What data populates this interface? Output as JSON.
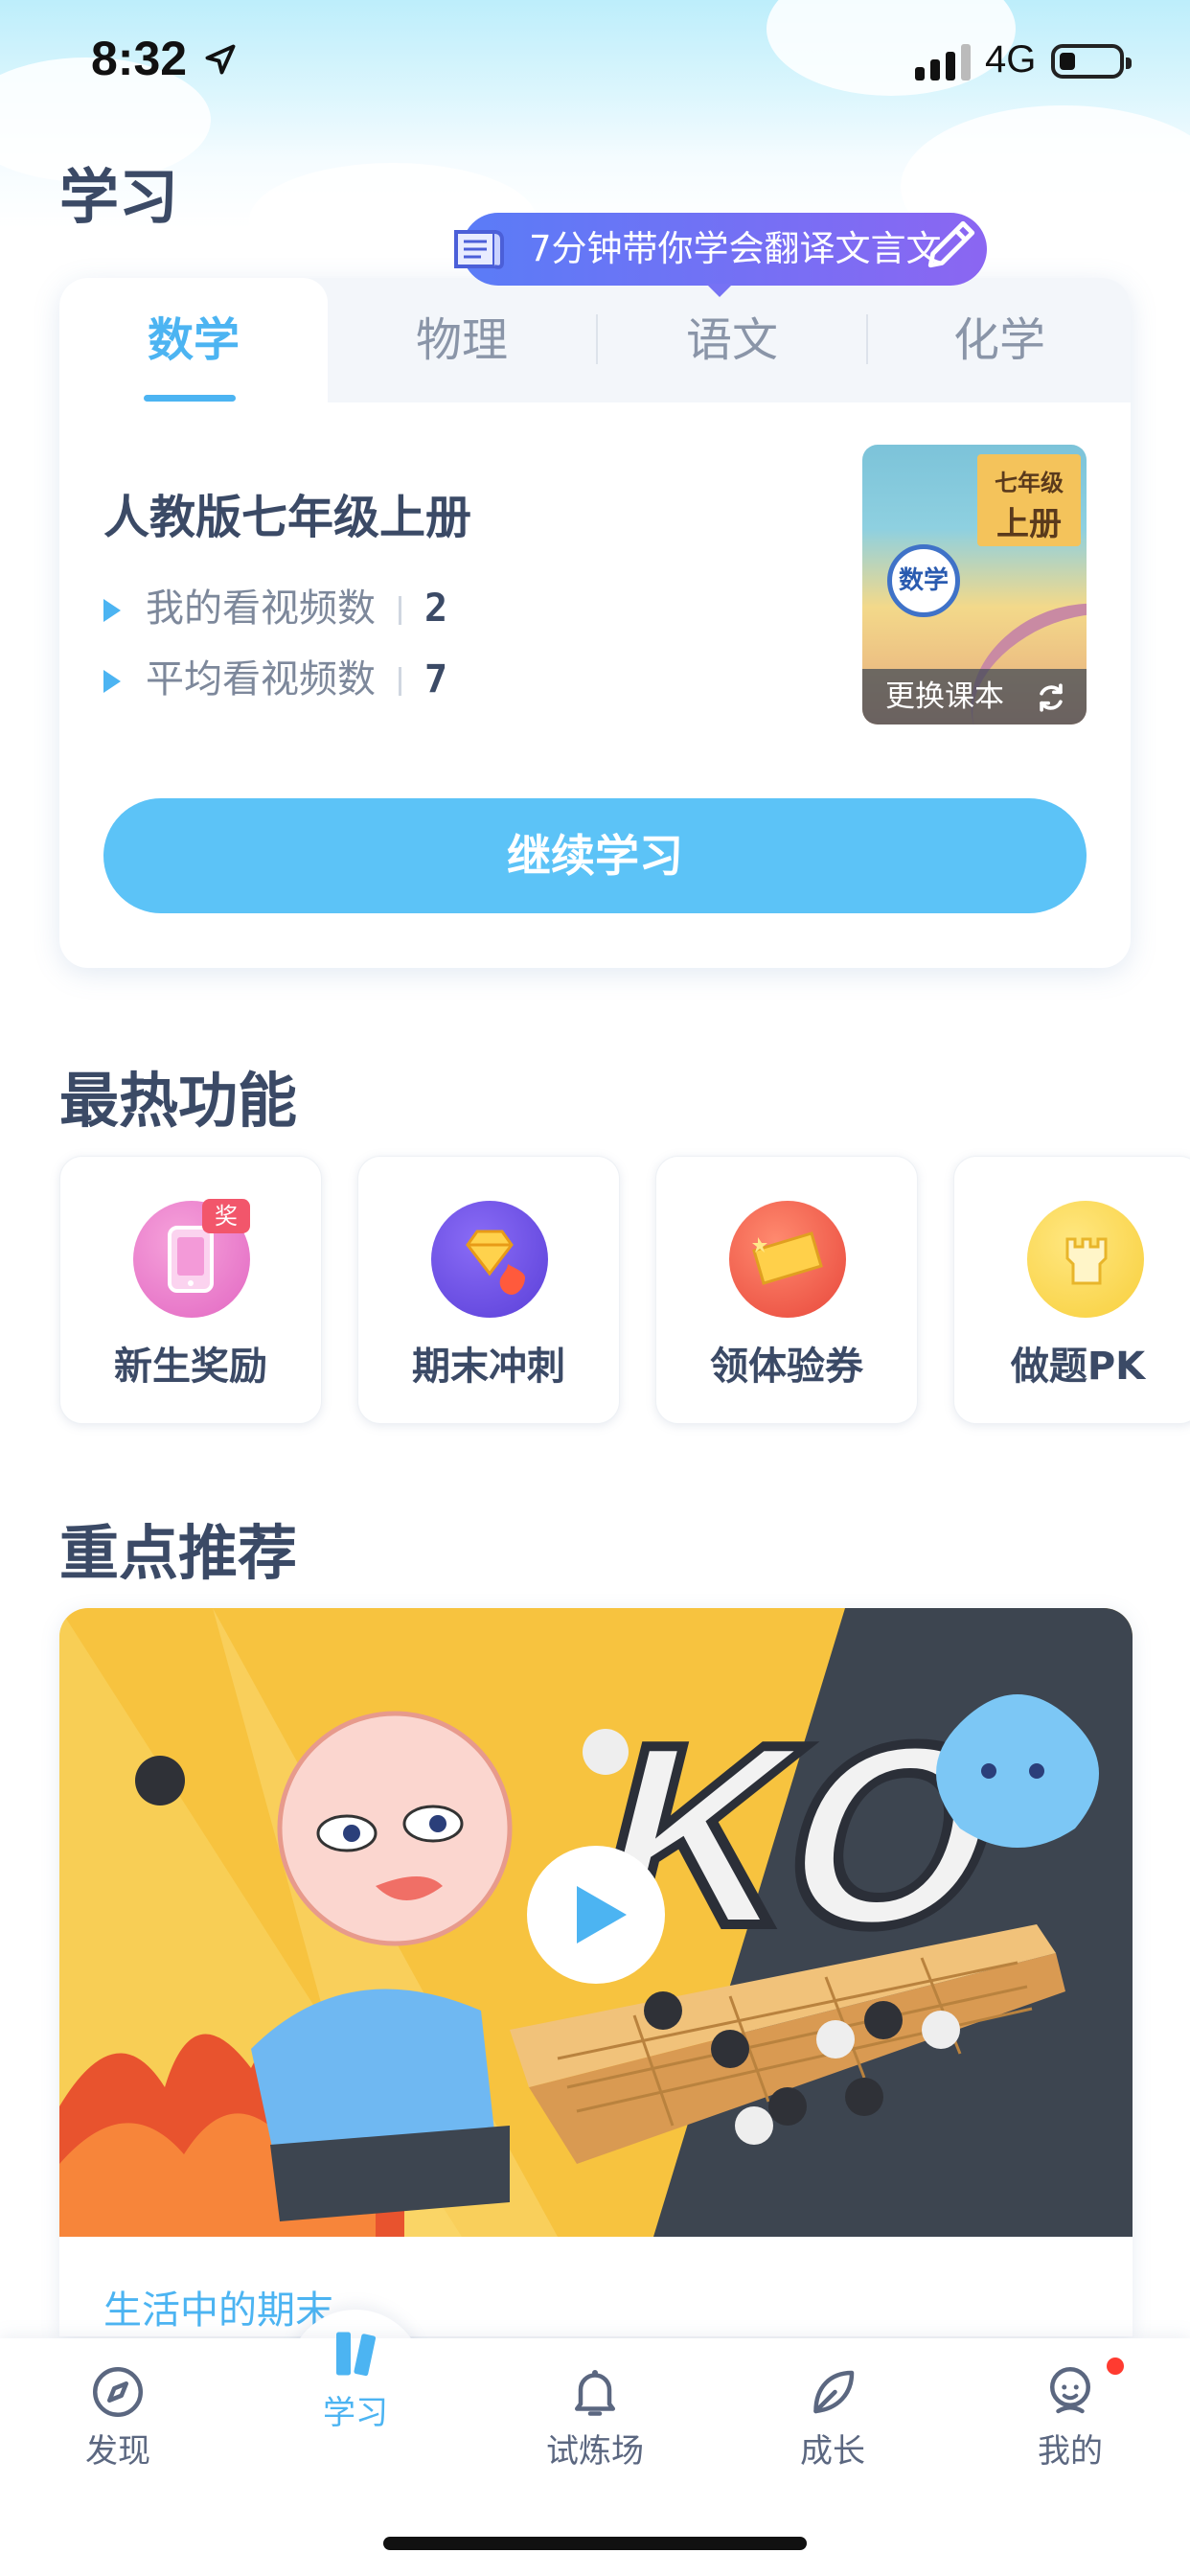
{
  "status_bar": {
    "time": "8:32",
    "network": "4G"
  },
  "page_title": "学习",
  "banner": {
    "text": "7分钟带你学会翻译文言文"
  },
  "subject_tabs": [
    {
      "label": "数学",
      "active": true
    },
    {
      "label": "物理",
      "active": false
    },
    {
      "label": "语文",
      "active": false
    },
    {
      "label": "化学",
      "active": false
    }
  ],
  "study_card": {
    "book_title": "人教版七年级上册",
    "stats": [
      {
        "label": "我的看视频数",
        "value": "2"
      },
      {
        "label": "平均看视频数",
        "value": "7"
      }
    ],
    "cover": {
      "grade_line1": "七年级",
      "grade_line2": "上册",
      "subject": "数学",
      "change_label": "更换课本"
    },
    "continue_label": "继续学习"
  },
  "hot_section": {
    "title": "最热功能",
    "items": [
      {
        "label": "新生奖励",
        "icon": "gift-phone-icon",
        "badge": "奖"
      },
      {
        "label": "期末冲刺",
        "icon": "diamond-fire-icon"
      },
      {
        "label": "领体验券",
        "icon": "ticket-icon"
      },
      {
        "label": "做题PK",
        "icon": "castle-icon"
      }
    ]
  },
  "recommend_section": {
    "title": "重点推荐",
    "card_caption": "生活中的期末",
    "banner_text": "KO"
  },
  "tab_bar": {
    "items": [
      {
        "label": "发现",
        "icon": "compass-icon",
        "active": false
      },
      {
        "label": "学习",
        "icon": "books-icon",
        "active": true
      },
      {
        "label": "试炼场",
        "icon": "bell-icon",
        "active": false
      },
      {
        "label": "成长",
        "icon": "leaf-icon",
        "active": false
      },
      {
        "label": "我的",
        "icon": "face-icon",
        "active": false,
        "notification": true
      }
    ]
  },
  "colors": {
    "accent": "#4cb4f2",
    "button": "#5cc3f7",
    "title": "#3b4a66",
    "banner_start": "#5a7cf7",
    "banner_end": "#8b66f2"
  }
}
